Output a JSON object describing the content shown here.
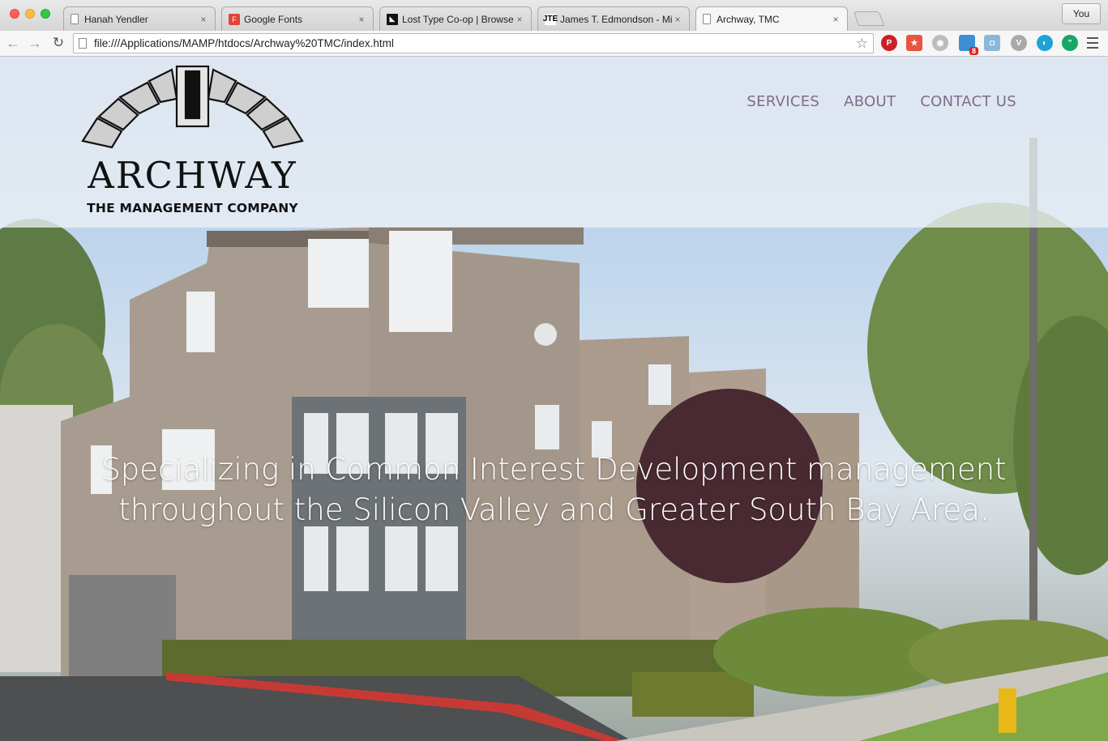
{
  "browser": {
    "tabs": [
      {
        "title": "Hanah Yendler",
        "favicon": "document-icon"
      },
      {
        "title": "Google Fonts",
        "favicon": "google-fonts-icon"
      },
      {
        "title": "Lost Type Co-op | Browse",
        "favicon": "lost-type-icon"
      },
      {
        "title": "James T. Edmondson - Mis",
        "favicon": "jte-icon"
      },
      {
        "title": "Archway, TMC",
        "favicon": "document-icon",
        "active": true
      }
    ],
    "profile_label": "You",
    "url": "file:///Applications/MAMP/htdocs/Archway%20TMC/index.html",
    "extension_badge": "8"
  },
  "site": {
    "brand_name": "ARCHWAY",
    "brand_subtitle": "THE MANAGEMENT COMPANY",
    "nav": [
      "SERVICES",
      "ABOUT",
      "CONTACT US"
    ],
    "tagline_line1": "Specializing in Common Interest Development management",
    "tagline_line2": "throughout the Silicon Valley and Greater South Bay Area.",
    "nav_color": "#7f6c8c"
  }
}
